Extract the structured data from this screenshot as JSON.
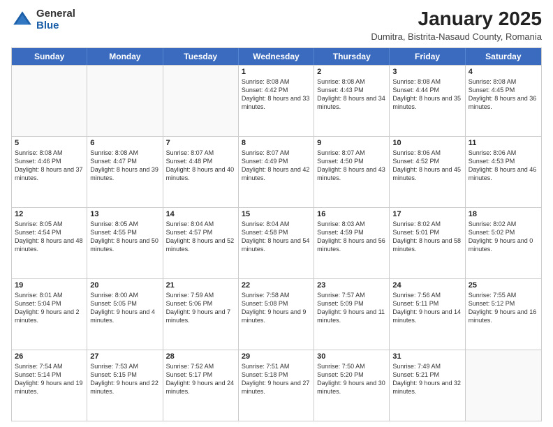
{
  "header": {
    "logo": {
      "line1": "General",
      "line2": "Blue"
    },
    "title": "January 2025",
    "subtitle": "Dumitra, Bistrita-Nasaud County, Romania"
  },
  "days_of_week": [
    "Sunday",
    "Monday",
    "Tuesday",
    "Wednesday",
    "Thursday",
    "Friday",
    "Saturday"
  ],
  "weeks": [
    [
      {
        "day": "",
        "empty": true
      },
      {
        "day": "",
        "empty": true
      },
      {
        "day": "",
        "empty": true
      },
      {
        "day": "1",
        "sunrise": "8:08 AM",
        "sunset": "4:42 PM",
        "daylight": "8 hours and 33 minutes."
      },
      {
        "day": "2",
        "sunrise": "8:08 AM",
        "sunset": "4:43 PM",
        "daylight": "8 hours and 34 minutes."
      },
      {
        "day": "3",
        "sunrise": "8:08 AM",
        "sunset": "4:44 PM",
        "daylight": "8 hours and 35 minutes."
      },
      {
        "day": "4",
        "sunrise": "8:08 AM",
        "sunset": "4:45 PM",
        "daylight": "8 hours and 36 minutes."
      }
    ],
    [
      {
        "day": "5",
        "sunrise": "8:08 AM",
        "sunset": "4:46 PM",
        "daylight": "8 hours and 37 minutes."
      },
      {
        "day": "6",
        "sunrise": "8:08 AM",
        "sunset": "4:47 PM",
        "daylight": "8 hours and 39 minutes."
      },
      {
        "day": "7",
        "sunrise": "8:07 AM",
        "sunset": "4:48 PM",
        "daylight": "8 hours and 40 minutes."
      },
      {
        "day": "8",
        "sunrise": "8:07 AM",
        "sunset": "4:49 PM",
        "daylight": "8 hours and 42 minutes."
      },
      {
        "day": "9",
        "sunrise": "8:07 AM",
        "sunset": "4:50 PM",
        "daylight": "8 hours and 43 minutes."
      },
      {
        "day": "10",
        "sunrise": "8:06 AM",
        "sunset": "4:52 PM",
        "daylight": "8 hours and 45 minutes."
      },
      {
        "day": "11",
        "sunrise": "8:06 AM",
        "sunset": "4:53 PM",
        "daylight": "8 hours and 46 minutes."
      }
    ],
    [
      {
        "day": "12",
        "sunrise": "8:05 AM",
        "sunset": "4:54 PM",
        "daylight": "8 hours and 48 minutes."
      },
      {
        "day": "13",
        "sunrise": "8:05 AM",
        "sunset": "4:55 PM",
        "daylight": "8 hours and 50 minutes."
      },
      {
        "day": "14",
        "sunrise": "8:04 AM",
        "sunset": "4:57 PM",
        "daylight": "8 hours and 52 minutes."
      },
      {
        "day": "15",
        "sunrise": "8:04 AM",
        "sunset": "4:58 PM",
        "daylight": "8 hours and 54 minutes."
      },
      {
        "day": "16",
        "sunrise": "8:03 AM",
        "sunset": "4:59 PM",
        "daylight": "8 hours and 56 minutes."
      },
      {
        "day": "17",
        "sunrise": "8:02 AM",
        "sunset": "5:01 PM",
        "daylight": "8 hours and 58 minutes."
      },
      {
        "day": "18",
        "sunrise": "8:02 AM",
        "sunset": "5:02 PM",
        "daylight": "9 hours and 0 minutes."
      }
    ],
    [
      {
        "day": "19",
        "sunrise": "8:01 AM",
        "sunset": "5:04 PM",
        "daylight": "9 hours and 2 minutes."
      },
      {
        "day": "20",
        "sunrise": "8:00 AM",
        "sunset": "5:05 PM",
        "daylight": "9 hours and 4 minutes."
      },
      {
        "day": "21",
        "sunrise": "7:59 AM",
        "sunset": "5:06 PM",
        "daylight": "9 hours and 7 minutes."
      },
      {
        "day": "22",
        "sunrise": "7:58 AM",
        "sunset": "5:08 PM",
        "daylight": "9 hours and 9 minutes."
      },
      {
        "day": "23",
        "sunrise": "7:57 AM",
        "sunset": "5:09 PM",
        "daylight": "9 hours and 11 minutes."
      },
      {
        "day": "24",
        "sunrise": "7:56 AM",
        "sunset": "5:11 PM",
        "daylight": "9 hours and 14 minutes."
      },
      {
        "day": "25",
        "sunrise": "7:55 AM",
        "sunset": "5:12 PM",
        "daylight": "9 hours and 16 minutes."
      }
    ],
    [
      {
        "day": "26",
        "sunrise": "7:54 AM",
        "sunset": "5:14 PM",
        "daylight": "9 hours and 19 minutes."
      },
      {
        "day": "27",
        "sunrise": "7:53 AM",
        "sunset": "5:15 PM",
        "daylight": "9 hours and 22 minutes."
      },
      {
        "day": "28",
        "sunrise": "7:52 AM",
        "sunset": "5:17 PM",
        "daylight": "9 hours and 24 minutes."
      },
      {
        "day": "29",
        "sunrise": "7:51 AM",
        "sunset": "5:18 PM",
        "daylight": "9 hours and 27 minutes."
      },
      {
        "day": "30",
        "sunrise": "7:50 AM",
        "sunset": "5:20 PM",
        "daylight": "9 hours and 30 minutes."
      },
      {
        "day": "31",
        "sunrise": "7:49 AM",
        "sunset": "5:21 PM",
        "daylight": "9 hours and 32 minutes."
      },
      {
        "day": "",
        "empty": true
      }
    ]
  ]
}
